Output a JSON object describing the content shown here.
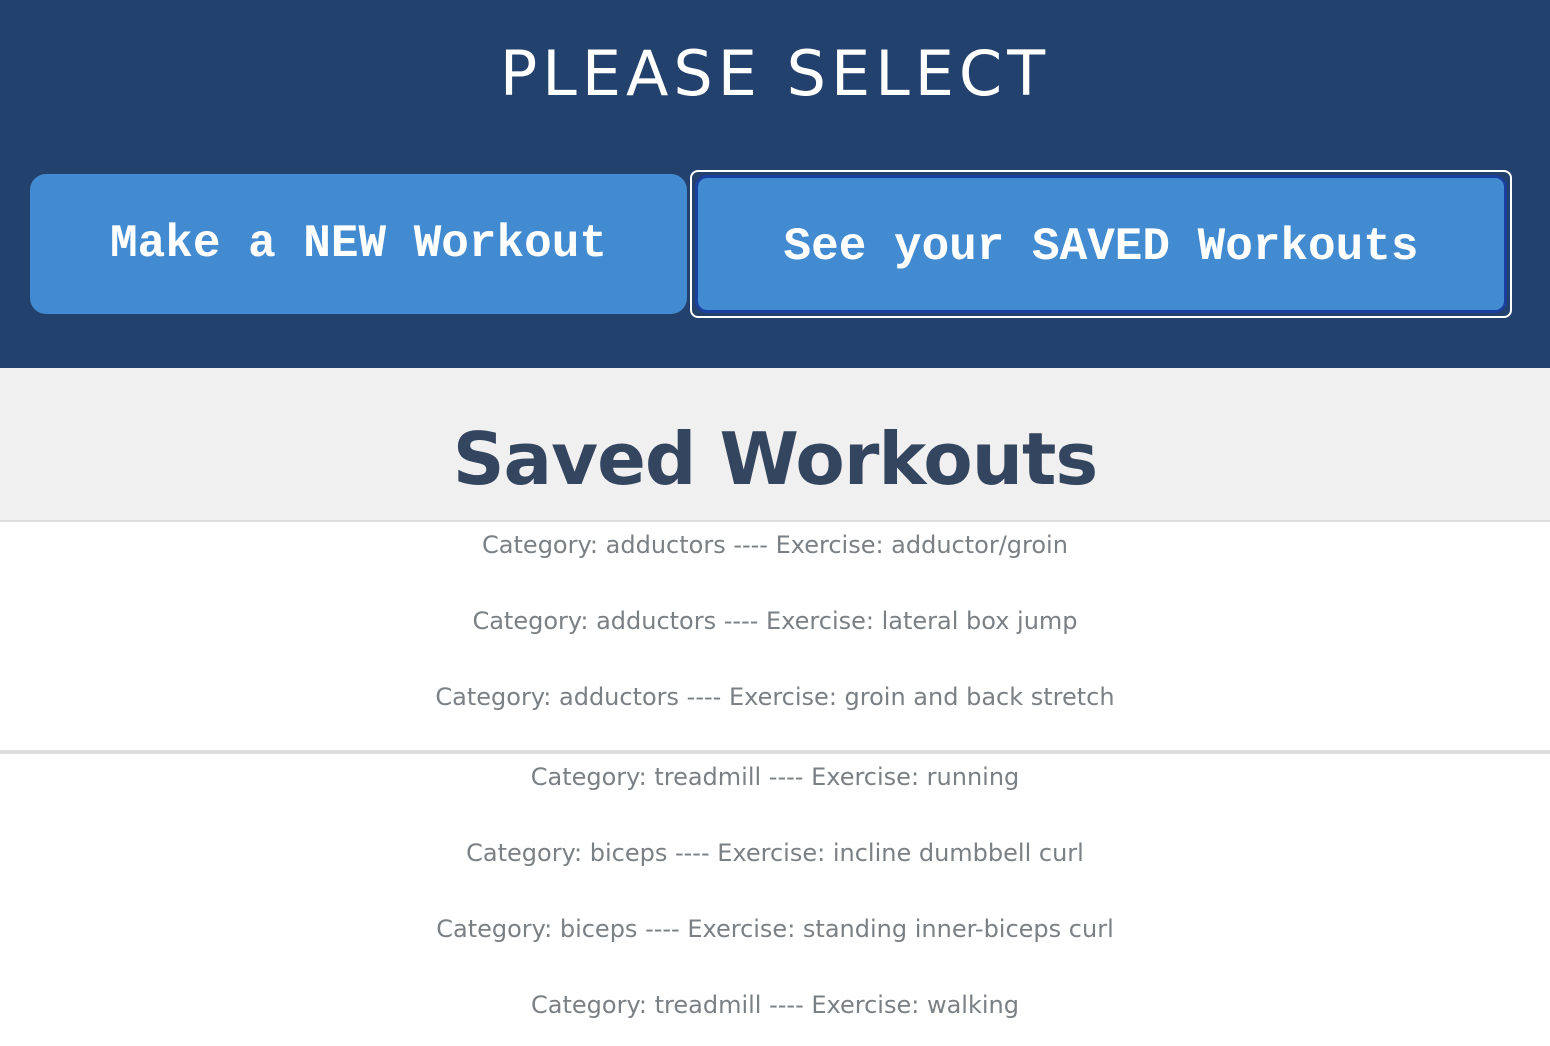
{
  "header": {
    "title": "PLEASE SELECT",
    "buttons": {
      "new_workout": "Make a NEW Workout",
      "saved_workouts": "See your SAVED Workouts"
    }
  },
  "saved": {
    "title": "Saved Workouts",
    "groups": [
      {
        "entries": [
          "Category: adductors ---- Exercise: adductor/groin",
          "Category: adductors ---- Exercise: lateral box jump",
          "Category: adductors ---- Exercise: groin and back stretch"
        ]
      },
      {
        "entries": [
          "Category: treadmill ---- Exercise: running",
          "Category: biceps ---- Exercise: incline dumbbell curl",
          "Category: biceps ---- Exercise: standing inner-biceps curl",
          "Category: treadmill ---- Exercise: walking"
        ]
      }
    ]
  },
  "colors": {
    "header_bg": "#23416d",
    "button_bg": "#428bd1",
    "saved_header_bg": "#f0f0f0",
    "title_color": "#34455f",
    "entry_color": "#7b8085"
  }
}
